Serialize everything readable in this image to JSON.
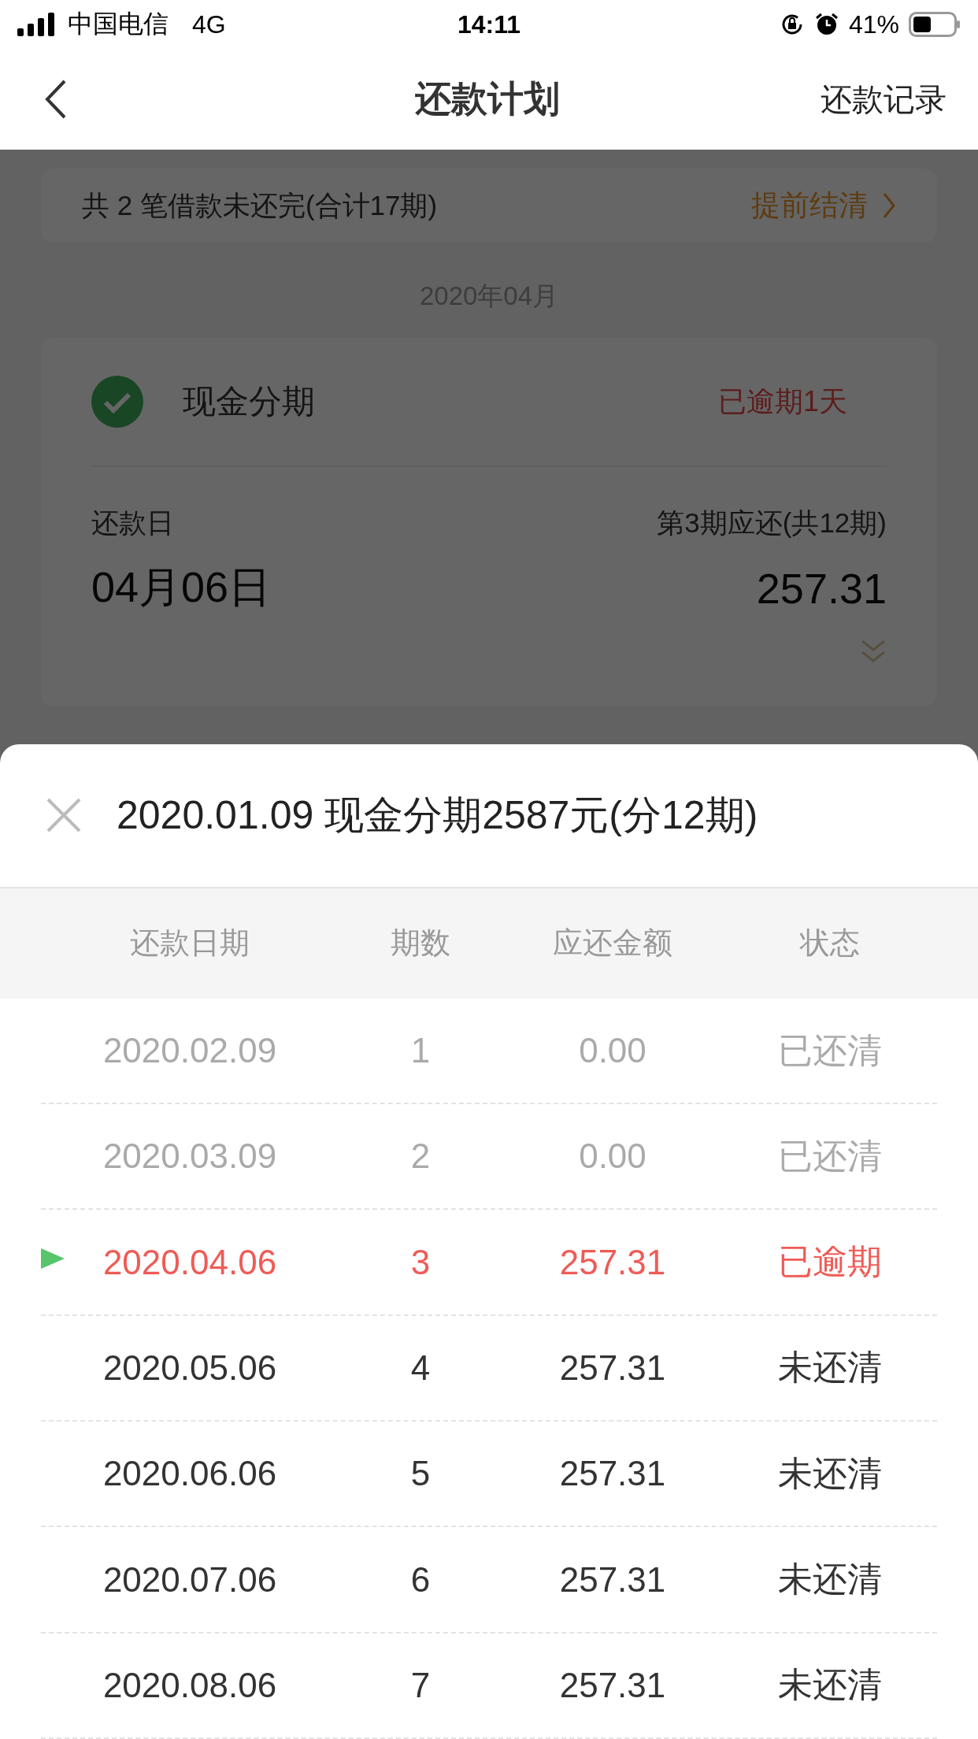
{
  "status_bar": {
    "carrier": "中国电信",
    "network": "4G",
    "time": "14:11",
    "battery": "41%"
  },
  "nav": {
    "title": "还款计划",
    "action": "还款记录"
  },
  "summary": {
    "text": "共 2 笔借款未还完(合计17期)",
    "action": "提前结清"
  },
  "month": "2020年04月",
  "loan_card": {
    "name": "现金分期",
    "status": "已逾期1天",
    "due_label": "还款日",
    "due_date": "04月06日",
    "amount_label": "第3期应还(共12期)",
    "amount": "257.31"
  },
  "sheet": {
    "title": "2020.01.09 现金分期2587元(分12期)",
    "columns": [
      "还款日期",
      "期数",
      "应还金额",
      "状态"
    ],
    "rows": [
      {
        "date": "2020.02.09",
        "period": "1",
        "amount": "0.00",
        "status": "已还清",
        "kind": "paid",
        "current": false
      },
      {
        "date": "2020.03.09",
        "period": "2",
        "amount": "0.00",
        "status": "已还清",
        "kind": "paid",
        "current": false
      },
      {
        "date": "2020.04.06",
        "period": "3",
        "amount": "257.31",
        "status": "已逾期",
        "kind": "overdue",
        "current": true
      },
      {
        "date": "2020.05.06",
        "period": "4",
        "amount": "257.31",
        "status": "未还清",
        "kind": "unpaid",
        "current": false
      },
      {
        "date": "2020.06.06",
        "period": "5",
        "amount": "257.31",
        "status": "未还清",
        "kind": "unpaid",
        "current": false
      },
      {
        "date": "2020.07.06",
        "period": "6",
        "amount": "257.31",
        "status": "未还清",
        "kind": "unpaid",
        "current": false
      },
      {
        "date": "2020.08.06",
        "period": "7",
        "amount": "257.31",
        "status": "未还清",
        "kind": "unpaid",
        "current": false
      }
    ]
  }
}
